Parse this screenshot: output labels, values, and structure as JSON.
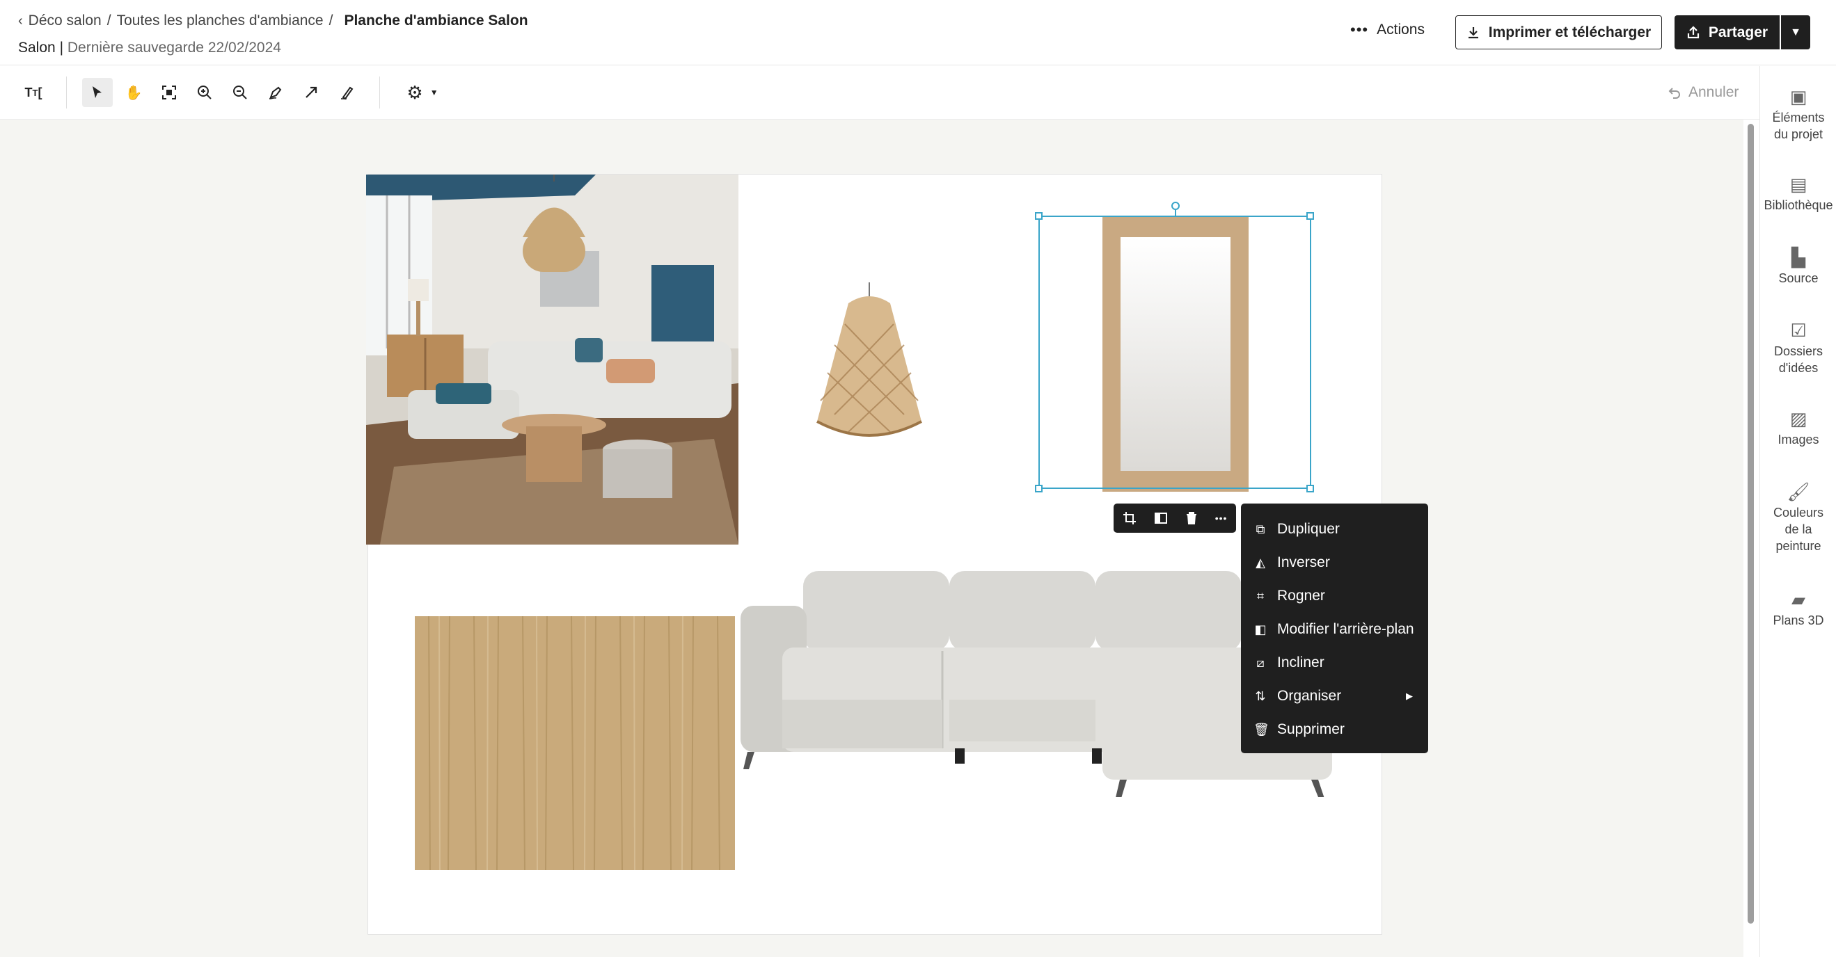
{
  "header": {
    "breadcrumb": {
      "parent": "Déco salon",
      "sep1": "/",
      "section": "Toutes les planches d'ambiance",
      "sep2": "/",
      "current": "Planche d'ambiance Salon"
    },
    "room": "Salon",
    "divider": "|",
    "last_saved": "Dernière sauvegarde 22/02/2024",
    "actions_label": "Actions",
    "print_label": "Imprimer et télécharger",
    "share_label": "Partager"
  },
  "toolbar": {
    "undo_label": "Annuler",
    "tools": [
      "text-tool-icon",
      "select-pointer-icon",
      "pan-hand-icon",
      "fit-screen-icon",
      "zoom-in-icon",
      "zoom-out-icon",
      "pen-tool-icon",
      "arrow-tool-icon",
      "eraser-tool-icon",
      "settings-gear-icon"
    ]
  },
  "sidebar": {
    "items": [
      {
        "label_line1": "Éléments",
        "label_line2": "du projet",
        "icon": "project-elements-icon"
      },
      {
        "label_line1": "Bibliothèque",
        "label_line2": "",
        "icon": "library-icon"
      },
      {
        "label_line1": "Source",
        "label_line2": "",
        "icon": "source-icon"
      },
      {
        "label_line1": "Dossiers",
        "label_line2": "d'idées",
        "icon": "idea-folders-icon"
      },
      {
        "label_line1": "Images",
        "label_line2": "",
        "icon": "images-icon"
      },
      {
        "label_line1": "Couleurs",
        "label_line2": "de la",
        "label_line3": "peinture",
        "icon": "paint-brush-icon"
      },
      {
        "label_line1": "Plans 3D",
        "label_line2": "",
        "icon": "plans-3d-icon"
      }
    ]
  },
  "context_menu": {
    "items": [
      {
        "label": "Dupliquer",
        "icon": "duplicate-icon"
      },
      {
        "label": "Inverser",
        "icon": "flip-icon"
      },
      {
        "label": "Rogner",
        "icon": "crop-icon"
      },
      {
        "label": "Modifier l'arrière-plan",
        "icon": "background-edit-icon"
      },
      {
        "label": "Incliner",
        "icon": "skew-icon"
      },
      {
        "label": "Organiser",
        "icon": "arrange-icon"
      },
      {
        "label": "Supprimer",
        "icon": "trash-icon"
      }
    ]
  },
  "colors": {
    "accent_selection": "#3aa5c9",
    "dark_button": "#1f1f1f",
    "canvas_bg": "#f5f5f2"
  }
}
